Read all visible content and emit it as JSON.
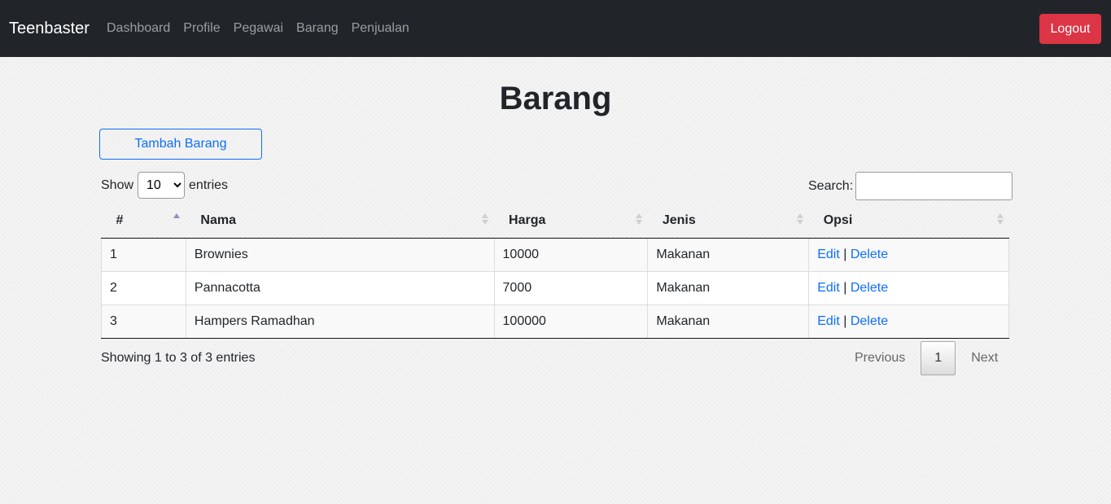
{
  "nav": {
    "brand": "Teenbaster",
    "links": [
      "Dashboard",
      "Profile",
      "Pegawai",
      "Barang",
      "Penjualan"
    ],
    "logout": "Logout"
  },
  "page": {
    "title": "Barang",
    "add_button": "Tambah Barang"
  },
  "table_controls": {
    "show_label": "Show",
    "entries_label": "entries",
    "page_length": "10",
    "search_label": "Search:",
    "search_value": ""
  },
  "table": {
    "columns": [
      "#",
      "Nama",
      "Harga",
      "Jenis",
      "Opsi"
    ],
    "rows": [
      {
        "no": "1",
        "nama": "Brownies",
        "harga": "10000",
        "jenis": "Makanan",
        "edit": "Edit",
        "sep": "|",
        "delete": "Delete"
      },
      {
        "no": "2",
        "nama": "Pannacotta",
        "harga": "7000",
        "jenis": "Makanan",
        "edit": "Edit",
        "sep": "|",
        "delete": "Delete"
      },
      {
        "no": "3",
        "nama": "Hampers Ramadhan",
        "harga": "100000",
        "jenis": "Makanan",
        "edit": "Edit",
        "sep": "|",
        "delete": "Delete"
      }
    ]
  },
  "footer": {
    "info": "Showing 1 to 3 of 3 entries",
    "previous": "Previous",
    "current_page": "1",
    "next": "Next"
  },
  "colors": {
    "navbar": "#212529",
    "logout": "#dc3545",
    "link": "#0d6efd"
  }
}
